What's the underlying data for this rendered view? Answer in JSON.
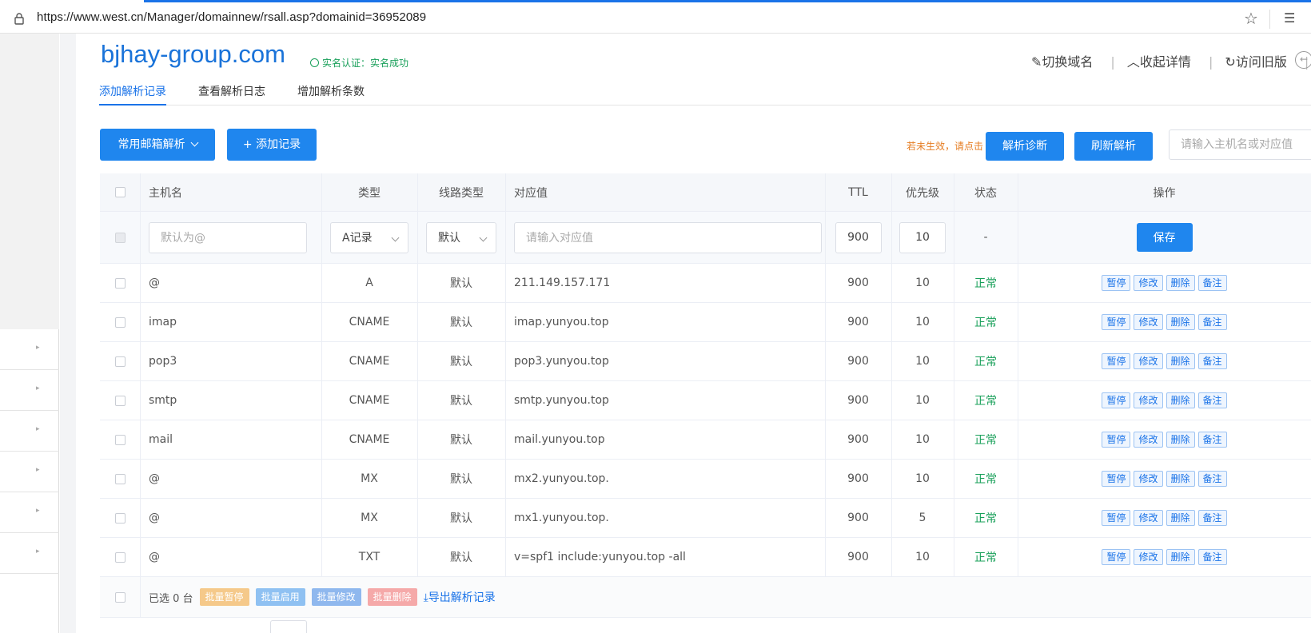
{
  "browser": {
    "url": "https://www.west.cn/Manager/domainnew/rsall.asp?domainid=36952089"
  },
  "header": {
    "domain": "bjhay-group.com",
    "verify": "实名认证：实名成功",
    "actions": [
      "切换域名",
      "收起详情",
      "访问旧版"
    ]
  },
  "tabs": [
    "添加解析记录",
    "查看解析日志",
    "增加解析条数"
  ],
  "toolbar": {
    "mail_btn": "常用邮箱解析",
    "add_btn": "+ 添加记录",
    "hint": "若未生效，请点击",
    "diagnose_btn": "解析诊断",
    "refresh_btn": "刷新解析",
    "search_placeholder": "请输入主机名或对应值"
  },
  "table": {
    "headers": [
      "主机名",
      "类型",
      "线路类型",
      "对应值",
      "TTL",
      "优先级",
      "状态",
      "操作"
    ],
    "input_row": {
      "host_placeholder": "默认为@",
      "type": "A记录",
      "line": "默认",
      "value_placeholder": "请输入对应值",
      "ttl": "900",
      "priority": "10",
      "status": "-",
      "save": "保存"
    },
    "rows": [
      {
        "host": "@",
        "type": "A",
        "line": "默认",
        "value": "211.149.157.171",
        "ttl": "900",
        "priority": "10",
        "status": "正常"
      },
      {
        "host": "imap",
        "type": "CNAME",
        "line": "默认",
        "value": "imap.yunyou.top",
        "ttl": "900",
        "priority": "10",
        "status": "正常"
      },
      {
        "host": "pop3",
        "type": "CNAME",
        "line": "默认",
        "value": "pop3.yunyou.top",
        "ttl": "900",
        "priority": "10",
        "status": "正常"
      },
      {
        "host": "smtp",
        "type": "CNAME",
        "line": "默认",
        "value": "smtp.yunyou.top",
        "ttl": "900",
        "priority": "10",
        "status": "正常"
      },
      {
        "host": "mail",
        "type": "CNAME",
        "line": "默认",
        "value": "mail.yunyou.top",
        "ttl": "900",
        "priority": "10",
        "status": "正常"
      },
      {
        "host": "@",
        "type": "MX",
        "line": "默认",
        "value": "mx2.yunyou.top.",
        "ttl": "900",
        "priority": "10",
        "status": "正常"
      },
      {
        "host": "@",
        "type": "MX",
        "line": "默认",
        "value": "mx1.yunyou.top.",
        "ttl": "900",
        "priority": "5",
        "status": "正常"
      },
      {
        "host": "@",
        "type": "TXT",
        "line": "默认",
        "value": "v=spf1 include:yunyou.top -all",
        "ttl": "900",
        "priority": "10",
        "status": "正常"
      }
    ],
    "row_ops": [
      "暂停",
      "修改",
      "删除",
      "备注"
    ],
    "footer": {
      "selected": "已选 0 台",
      "bulk": [
        {
          "label": "批量暂停",
          "color": "#f5c98a"
        },
        {
          "label": "批量启用",
          "color": "#8fc1f2"
        },
        {
          "label": "批量修改",
          "color": "#8fb8ee"
        },
        {
          "label": "批量删除",
          "color": "#f5a9a9"
        }
      ],
      "export": "导出解析记录"
    }
  },
  "colors": {
    "primary": "#1f86ee",
    "status_ok": "#19a05a",
    "hint": "#e67d22"
  }
}
